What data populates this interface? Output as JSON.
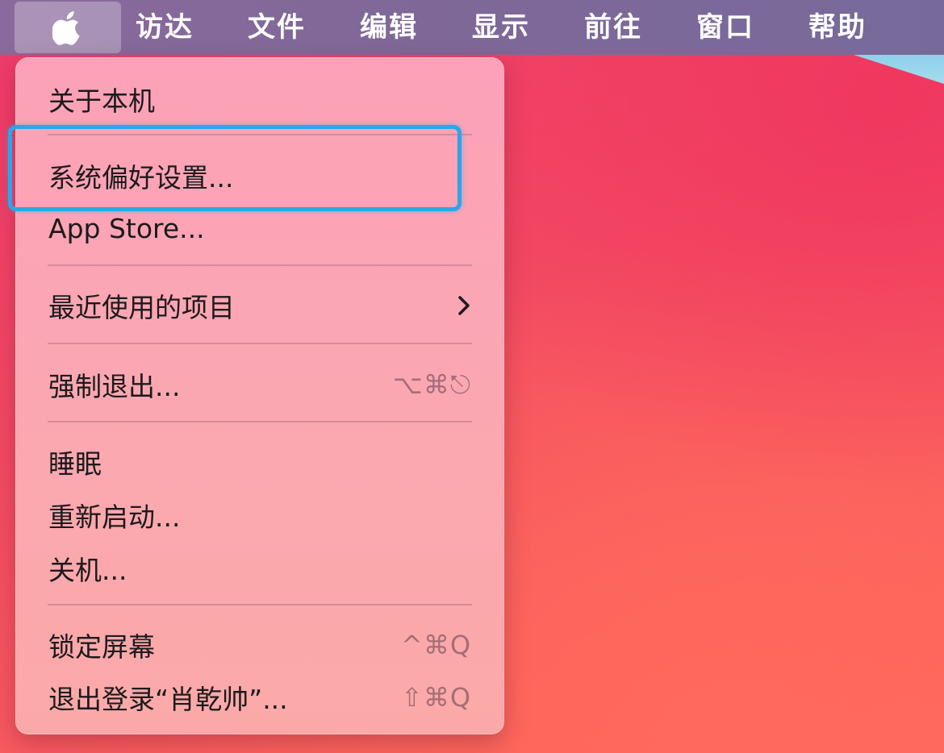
{
  "menubar": {
    "apple_icon": "apple-logo-icon",
    "items": [
      {
        "label": "访达"
      },
      {
        "label": "文件"
      },
      {
        "label": "编辑"
      },
      {
        "label": "显示"
      },
      {
        "label": "前往"
      },
      {
        "label": "窗口"
      },
      {
        "label": "帮助"
      }
    ]
  },
  "apple_menu": {
    "about": "关于本机",
    "system_preferences": "系统偏好设置...",
    "app_store": "App Store...",
    "recent_items": "最近使用的项目",
    "recent_items_icon": "chevron-right-icon",
    "force_quit": "强制退出...",
    "force_quit_shortcut": "⌥⌘⎋",
    "sleep": "睡眠",
    "restart": "重新启动...",
    "shut_down": "关机...",
    "lock_screen": "锁定屏幕",
    "lock_screen_shortcut": "^⌘Q",
    "log_out": "退出登录“肖乾帅”...",
    "log_out_shortcut": "⇧⌘Q"
  },
  "highlight": {
    "color": "#2aa6ea"
  }
}
